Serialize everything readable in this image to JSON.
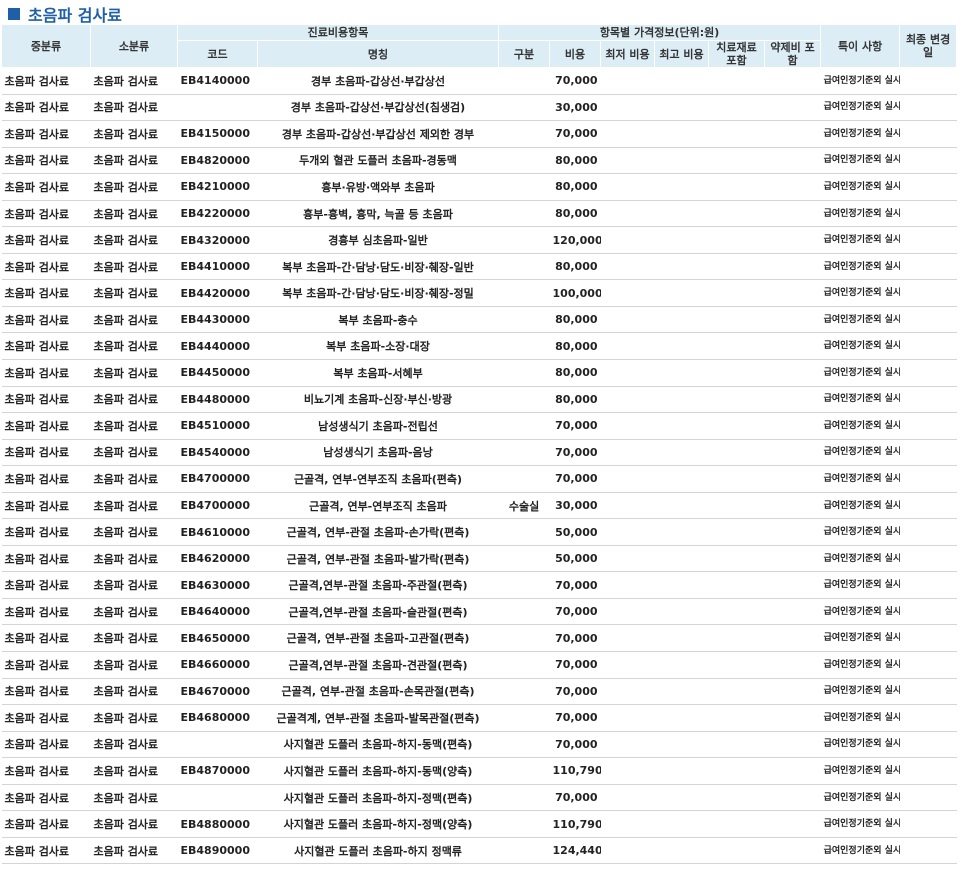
{
  "page": {
    "title": "초음파 검사료",
    "accent_color": "#1f5fa8",
    "header_bg": "#dcedf5"
  },
  "headers": {
    "mid": "중분류",
    "sub": "소분류",
    "group_items": "진료비용항목",
    "code": "코드",
    "name": "명칭",
    "group_price": "항목별 가격정보(단위:원)",
    "type": "구분",
    "cost": "비용",
    "min": "최저 비용",
    "max": "최고 비용",
    "material": "치료재료 포함",
    "drug": "약제비 포함",
    "note": "특이 사항",
    "changed": "최종 변경일"
  },
  "rows": [
    {
      "mid": "초음파 검사료",
      "sub": "초음파 검사료",
      "code": "EB4140000",
      "name": "경부 초음파-갑상선·부갑상선",
      "type": "",
      "cost": "70,000",
      "note": "급여인정기준외 실시한경우비급여"
    },
    {
      "mid": "초음파 검사료",
      "sub": "초음파 검사료",
      "code": "",
      "name": "경부 초음파-갑상선·부갑상선(침생검)",
      "type": "",
      "cost": "30,000",
      "note": "급여인정기준외 실시한경우비급여"
    },
    {
      "mid": "초음파 검사료",
      "sub": "초음파 검사료",
      "code": "EB4150000",
      "name": "경부 초음파-갑상선·부갑상선 제외한 경부",
      "type": "",
      "cost": "70,000",
      "note": "급여인정기준외 실시한경우비급여"
    },
    {
      "mid": "초음파 검사료",
      "sub": "초음파 검사료",
      "code": "EB4820000",
      "name": "두개외 혈관 도플러 초음파-경동맥",
      "type": "",
      "cost": "80,000",
      "note": "급여인정기준외 실시한경우비급여"
    },
    {
      "mid": "초음파 검사료",
      "sub": "초음파 검사료",
      "code": "EB4210000",
      "name": "흉부·유방·액와부 초음파",
      "type": "",
      "cost": "80,000",
      "note": "급여인정기준외 실시한경우비급여"
    },
    {
      "mid": "초음파 검사료",
      "sub": "초음파 검사료",
      "code": "EB4220000",
      "name": "흉부-흉벽, 흉막, 늑골 등 초음파",
      "type": "",
      "cost": "80,000",
      "note": "급여인정기준외 실시한경우비급여"
    },
    {
      "mid": "초음파 검사료",
      "sub": "초음파 검사료",
      "code": "EB4320000",
      "name": "경흉부 심초음파-일반",
      "type": "",
      "cost": "120,000",
      "note": "급여인정기준외 실시한경우비급여"
    },
    {
      "mid": "초음파 검사료",
      "sub": "초음파 검사료",
      "code": "EB4410000",
      "name": "복부 초음파-간·담낭·담도·비장·췌장-일반",
      "type": "",
      "cost": "80,000",
      "note": "급여인정기준외 실시한경우비급여"
    },
    {
      "mid": "초음파 검사료",
      "sub": "초음파 검사료",
      "code": "EB4420000",
      "name": "복부 초음파-간·담낭·담도·비장·췌장-정밀",
      "type": "",
      "cost": "100,000",
      "note": "급여인정기준외 실시한경우비급여"
    },
    {
      "mid": "초음파 검사료",
      "sub": "초음파 검사료",
      "code": "EB4430000",
      "name": "복부 초음파-충수",
      "type": "",
      "cost": "80,000",
      "note": "급여인정기준외 실시한경우비급여"
    },
    {
      "mid": "초음파 검사료",
      "sub": "초음파 검사료",
      "code": "EB4440000",
      "name": "복부 초음파-소장·대장",
      "type": "",
      "cost": "80,000",
      "note": "급여인정기준외 실시한경우비급여"
    },
    {
      "mid": "초음파 검사료",
      "sub": "초음파 검사료",
      "code": "EB4450000",
      "name": "복부 초음파-서혜부",
      "type": "",
      "cost": "80,000",
      "note": "급여인정기준외 실시한경우비급여"
    },
    {
      "mid": "초음파 검사료",
      "sub": "초음파 검사료",
      "code": "EB4480000",
      "name": "비뇨기계 초음파-신장·부신·방광",
      "type": "",
      "cost": "80,000",
      "note": "급여인정기준외 실시한경우비급여"
    },
    {
      "mid": "초음파 검사료",
      "sub": "초음파 검사료",
      "code": "EB4510000",
      "name": "남성생식기 초음파-전립선",
      "type": "",
      "cost": "70,000",
      "note": "급여인정기준외 실시한경우비급여"
    },
    {
      "mid": "초음파 검사료",
      "sub": "초음파 검사료",
      "code": "EB4540000",
      "name": "남성생식기 초음파-음낭",
      "type": "",
      "cost": "70,000",
      "note": "급여인정기준외 실시한경우비급여"
    },
    {
      "mid": "초음파 검사료",
      "sub": "초음파 검사료",
      "code": "EB4700000",
      "name": "근골격, 연부-연부조직 초음파(편측)",
      "type": "",
      "cost": "70,000",
      "note": "급여인정기준외 실시한경우비급여"
    },
    {
      "mid": "초음파 검사료",
      "sub": "초음파 검사료",
      "code": "EB4700000",
      "name": "근골격, 연부-연부조직 초음파",
      "type": "수술실",
      "cost": "30,000",
      "note": "급여인정기준외 실시한경우비급여"
    },
    {
      "mid": "초음파 검사료",
      "sub": "초음파 검사료",
      "code": "EB4610000",
      "name": "근골격, 연부-관절 초음파-손가락(편측)",
      "type": "",
      "cost": "50,000",
      "note": "급여인정기준외 실시한경우비급여"
    },
    {
      "mid": "초음파 검사료",
      "sub": "초음파 검사료",
      "code": "EB4620000",
      "name": "근골격, 연부-관절 초음파-발가락(편측)",
      "type": "",
      "cost": "50,000",
      "note": "급여인정기준외 실시한경우비급여"
    },
    {
      "mid": "초음파 검사료",
      "sub": "초음파 검사료",
      "code": "EB4630000",
      "name": "근골격,연부-관절 초음파-주관절(편측)",
      "type": "",
      "cost": "70,000",
      "note": "급여인정기준외 실시한경우비급여"
    },
    {
      "mid": "초음파 검사료",
      "sub": "초음파 검사료",
      "code": "EB4640000",
      "name": "근골격,연부-관절 초음파-슬관절(편측)",
      "type": "",
      "cost": "70,000",
      "note": "급여인정기준외 실시한경우비급여"
    },
    {
      "mid": "초음파 검사료",
      "sub": "초음파 검사료",
      "code": "EB4650000",
      "name": "근골격, 연부-관절 초음파-고관절(편측)",
      "type": "",
      "cost": "70,000",
      "note": "급여인정기준외 실시한경우비급여"
    },
    {
      "mid": "초음파 검사료",
      "sub": "초음파 검사료",
      "code": "EB4660000",
      "name": "근골격,연부-관절 초음파-견관절(편측)",
      "type": "",
      "cost": "70,000",
      "note": "급여인정기준외 실시한경우비급여"
    },
    {
      "mid": "초음파 검사료",
      "sub": "초음파 검사료",
      "code": "EB4670000",
      "name": "근골격, 연부-관절 초음파-손목관절(편측)",
      "type": "",
      "cost": "70,000",
      "note": "급여인정기준외 실시한경우비급여"
    },
    {
      "mid": "초음파 검사료",
      "sub": "초음파 검사료",
      "code": "EB4680000",
      "name": "근골격계, 연부-관절 초음파-발목관절(편측)",
      "type": "",
      "cost": "70,000",
      "note": "급여인정기준외 실시한경우비급여"
    },
    {
      "mid": "초음파 검사료",
      "sub": "초음파 검사료",
      "code": "",
      "name": "사지혈관 도플러 초음파-하지-동맥(편측)",
      "type": "",
      "cost": "70,000",
      "note": "급여인정기준외 실시한경우비급여"
    },
    {
      "mid": "초음파 검사료",
      "sub": "초음파 검사료",
      "code": "EB4870000",
      "name": "사지혈관 도플러 초음파-하지-동맥(양측)",
      "type": "",
      "cost": "110,790",
      "note": "급여인정기준외 실시한경우비급여"
    },
    {
      "mid": "초음파 검사료",
      "sub": "초음파 검사료",
      "code": "",
      "name": "사지혈관 도플러 초음파-하지-정맥(편측)",
      "type": "",
      "cost": "70,000",
      "note": "급여인정기준외 실시한경우비급여"
    },
    {
      "mid": "초음파 검사료",
      "sub": "초음파 검사료",
      "code": "EB4880000",
      "name": "사지혈관 도플러 초음파-하지-정맥(양측)",
      "type": "",
      "cost": "110,790",
      "note": "급여인정기준외 실시한경우비급여"
    },
    {
      "mid": "초음파 검사료",
      "sub": "초음파 검사료",
      "code": "EB4890000",
      "name": "사지혈관 도플러 초음파-하지 정맥류",
      "type": "",
      "cost": "124,440",
      "note": "급여인정기준외 실시한경우비급여"
    }
  ]
}
